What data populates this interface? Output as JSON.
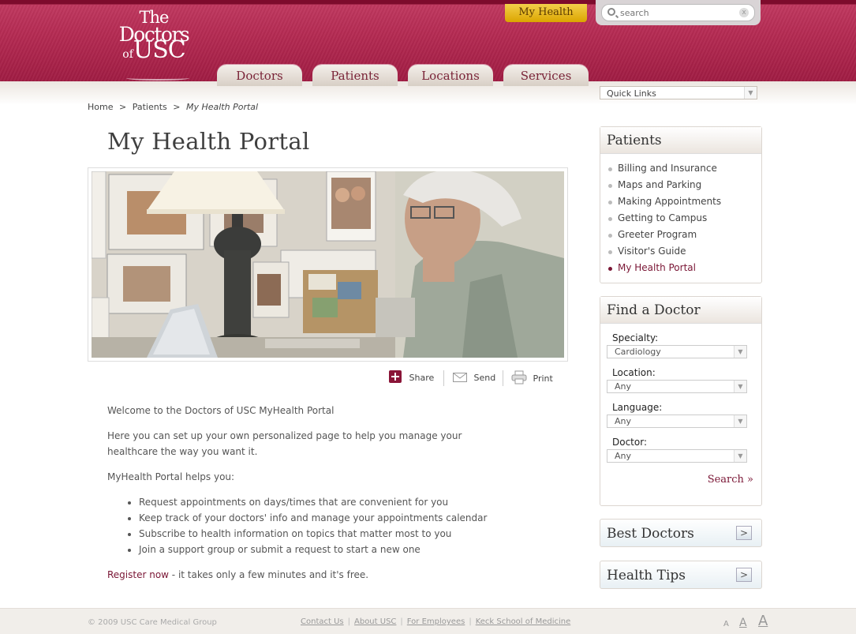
{
  "header": {
    "logo": {
      "line1": "The",
      "line2": "Doctors",
      "line3_small": "of",
      "line3_big": "USC"
    },
    "my_health_label": "My Health",
    "search": {
      "placeholder": "search",
      "clear_label": "x"
    },
    "nav": [
      "Doctors",
      "Patients",
      "Locations",
      "Services"
    ]
  },
  "quick_links": {
    "label": "Quick Links"
  },
  "breadcrumb": {
    "home": "Home",
    "sep1": ">",
    "patients": "Patients",
    "sep2": ">",
    "current": "My Health Portal"
  },
  "page_title": "My Health Portal",
  "actions": {
    "share": "Share",
    "send": "Send",
    "print": "Print"
  },
  "content": {
    "welcome": "Welcome to the Doctors of USC MyHealth Portal",
    "intro": "Here you can set up your own personalized page to help you manage your healthcare the way you want it.",
    "helps": "MyHealth Portal helps you:",
    "bullets": [
      "Request appointments on days/times that are convenient for you",
      "Keep track of your doctors' info and manage your appointments calendar",
      "Subscribe to health information on topics that matter most to you",
      "Join a support group or submit a request to start a new one"
    ],
    "register_link": "Register now",
    "register_rest": " - it takes only a few minutes and it's free."
  },
  "sidebar": {
    "patients": {
      "title": "Patients",
      "items": [
        "Billing and Insurance",
        "Maps and Parking",
        "Making Appointments",
        "Getting to Campus",
        "Greeter Program",
        "Visitor's Guide",
        "My Health Portal"
      ]
    },
    "find_doctor": {
      "title": "Find a Doctor",
      "specialty_label": "Specialty:",
      "specialty_value": "Cardiology",
      "location_label": "Location:",
      "location_value": "Any",
      "language_label": "Language:",
      "language_value": "Any",
      "doctor_label": "Doctor:",
      "doctor_value": "Any",
      "search_label": "Search »"
    },
    "best_doctors": "Best Doctors",
    "health_tips": "Health Tips",
    "go_label": ">"
  },
  "footer": {
    "copyright": "© 2009 USC Care Medical Group",
    "links": [
      "Contact Us",
      "About USC",
      "For Employees",
      "Keck School of Medicine"
    ],
    "bar": "|",
    "text_size": [
      "A",
      "A",
      "A"
    ]
  },
  "colors": {
    "brand": "#a01c43",
    "accent": "#7a1635",
    "gold": "#dba500"
  }
}
